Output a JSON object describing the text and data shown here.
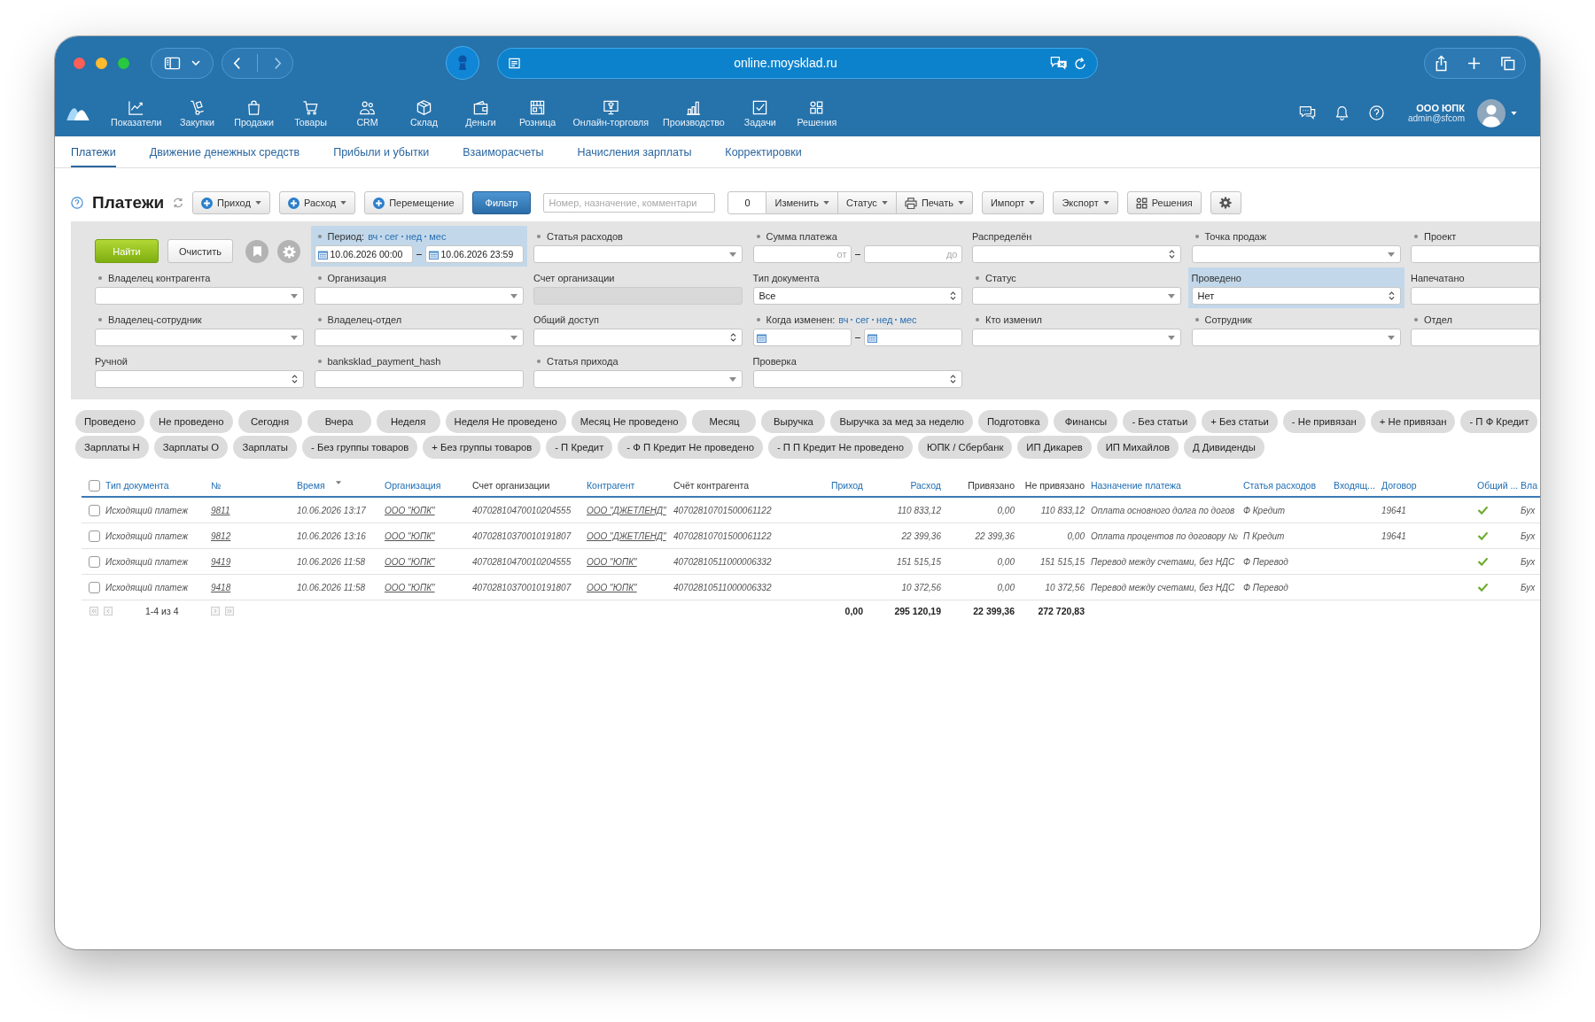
{
  "browser": {
    "url": "online.moysklad.ru"
  },
  "app_nav": {
    "items": [
      {
        "label": "Показатели"
      },
      {
        "label": "Закупки"
      },
      {
        "label": "Продажи"
      },
      {
        "label": "Товары"
      },
      {
        "label": "CRM"
      },
      {
        "label": "Склад"
      },
      {
        "label": "Деньги"
      },
      {
        "label": "Розница"
      },
      {
        "label": "Онлайн-торговля"
      },
      {
        "label": "Производство"
      },
      {
        "label": "Задачи"
      },
      {
        "label": "Решения"
      }
    ],
    "account": {
      "company": "ООО ЮПК",
      "email": "admin@sfcom"
    }
  },
  "tabs": [
    {
      "label": "Платежи",
      "selected": true
    },
    {
      "label": "Движение денежных средств",
      "selected": false
    },
    {
      "label": "Прибыли и убытки",
      "selected": false
    },
    {
      "label": "Взаиморасчеты",
      "selected": false
    },
    {
      "label": "Начисления зарплаты",
      "selected": false
    },
    {
      "label": "Корректировки",
      "selected": false
    }
  ],
  "toolbar": {
    "title": "Платежи",
    "buttons": [
      {
        "kind": "plus",
        "label": "Приход",
        "caret": true,
        "on": false
      },
      {
        "kind": "plus",
        "label": "Расход",
        "caret": true,
        "on": false
      },
      {
        "kind": "plus",
        "label": "Перемещение",
        "caret": false,
        "on": false
      },
      {
        "kind": "plain",
        "label": "Фильтр",
        "caret": false,
        "on": true
      }
    ],
    "search": {
      "placeholder": "Номер, назначение, комментари"
    },
    "selection": {
      "count": "0",
      "buttons": [
        {
          "kind": "plain",
          "label": "Изменить",
          "caret": true
        },
        {
          "kind": "plain",
          "label": "Статус",
          "caret": true
        },
        {
          "kind": "printer",
          "label": "Печать",
          "caret": true
        }
      ]
    },
    "more_buttons": [
      {
        "kind": "plain",
        "label": "Импорт",
        "caret": true
      },
      {
        "kind": "plain",
        "label": "Экспорт",
        "caret": true
      },
      {
        "kind": "apps",
        "label": "Решения",
        "caret": false
      }
    ]
  },
  "filter": {
    "find": "Найти",
    "clear": "Очистить",
    "fields": [
      {
        "label": "Период:",
        "kind": "date_range",
        "bulleted": true,
        "active": true,
        "disabled": false,
        "links": [
          "вч",
          "сег",
          "нед",
          "мес"
        ],
        "from": {
          "value": "10.06.2026 00:00"
        },
        "to": {
          "value": "10.06.2026 23:59"
        }
      },
      {
        "label": "Статья расходов",
        "kind": "dropdown",
        "bulleted": true,
        "active": false,
        "disabled": false
      },
      {
        "label": "Сумма платежа",
        "kind": "range",
        "bulleted": true,
        "active": false,
        "disabled": false,
        "from": {
          "placeholder": "от"
        },
        "to": {
          "placeholder": "до"
        }
      },
      {
        "label": "Распределён",
        "kind": "select",
        "bulleted": false,
        "active": false,
        "disabled": false
      },
      {
        "label": "Точка продаж",
        "kind": "dropdown",
        "bulleted": true,
        "active": false,
        "disabled": false
      },
      {
        "label": "Проект",
        "kind": "text",
        "bulleted": true,
        "active": false,
        "disabled": false
      },
      {
        "label": "Владелец контрагента",
        "kind": "dropdown",
        "bulleted": true,
        "active": false,
        "disabled": false
      },
      {
        "label": "Организация",
        "kind": "dropdown",
        "bulleted": true,
        "active": false,
        "disabled": false
      },
      {
        "label": "Счет организации",
        "kind": "text",
        "bulleted": false,
        "active": false,
        "disabled": true
      },
      {
        "label": "Тип документа",
        "kind": "select",
        "bulleted": false,
        "active": false,
        "disabled": false,
        "value": "Все"
      },
      {
        "label": "Статус",
        "kind": "dropdown",
        "bulleted": true,
        "active": false,
        "disabled": false
      },
      {
        "label": "Проведено",
        "kind": "select",
        "bulleted": false,
        "active": true,
        "disabled": false,
        "value": "Нет"
      },
      {
        "label": "Напечатано",
        "kind": "text",
        "bulleted": false,
        "active": false,
        "disabled": false
      },
      {
        "label": "Владелец-сотрудник",
        "kind": "dropdown",
        "bulleted": true,
        "active": false,
        "disabled": false
      },
      {
        "label": "Владелец-отдел",
        "kind": "dropdown",
        "bulleted": true,
        "active": false,
        "disabled": false
      },
      {
        "label": "Общий доступ",
        "kind": "select",
        "bulleted": false,
        "active": false,
        "disabled": false
      },
      {
        "label": "Когда изменен:",
        "kind": "date_range",
        "bulleted": true,
        "active": false,
        "disabled": false,
        "links": [
          "вч",
          "сег",
          "нед",
          "мес"
        ]
      },
      {
        "label": "Кто изменил",
        "kind": "dropdown",
        "bulleted": true,
        "active": false,
        "disabled": false
      },
      {
        "label": "Сотрудник",
        "kind": "dropdown",
        "bulleted": true,
        "active": false,
        "disabled": false
      },
      {
        "label": "Отдел",
        "kind": "text",
        "bulleted": true,
        "active": false,
        "disabled": false
      },
      {
        "label": "Ручной",
        "kind": "select",
        "bulleted": false,
        "active": false,
        "disabled": false
      },
      {
        "label": "banksklad_payment_hash",
        "kind": "text",
        "bulleted": true,
        "active": false,
        "disabled": false
      },
      {
        "label": "Статья прихода",
        "kind": "dropdown",
        "bulleted": true,
        "active": false,
        "disabled": false
      },
      {
        "label": "Проверка",
        "kind": "select",
        "bulleted": false,
        "active": false,
        "disabled": false
      }
    ]
  },
  "presets": [
    [
      "Проведено",
      "Не проведено",
      "Сегодня",
      "Вчера",
      "Неделя",
      "Неделя Не проведено",
      "Месяц Не проведено",
      "Месяц",
      "Выручка",
      "Выручка за мед за неделю",
      "Подготовка",
      "Финансы",
      "- Без статьи",
      "+ Без статьи",
      "- Не привязан",
      "+ Не привязан",
      "- П Ф Кредит"
    ],
    [
      "Зарплаты Н",
      "Зарплаты О",
      "Зарплаты",
      "- Без группы товаров",
      "+ Без группы товаров",
      "- П Кредит",
      "- Ф П Кредит Не проведено",
      "- П П Кредит Не проведено",
      "ЮПК / Сбербанк",
      "ИП Дикарев",
      "ИП Михайлов",
      "Д Дивиденды"
    ]
  ],
  "table": {
    "header_checked": false,
    "columns": [
      {
        "label": "Тип документа",
        "kind": "text",
        "sortable": true,
        "sorted": false
      },
      {
        "label": "№",
        "kind": "link",
        "sortable": true,
        "sorted": false
      },
      {
        "label": "Время",
        "kind": "text",
        "sortable": true,
        "sorted": true
      },
      {
        "label": "Организация",
        "kind": "link",
        "sortable": true,
        "sorted": false
      },
      {
        "label": "Счет организации",
        "kind": "text",
        "sortable": false,
        "sorted": false
      },
      {
        "label": "Контрагент",
        "kind": "link",
        "sortable": true,
        "sorted": false
      },
      {
        "label": "Счёт контрагента",
        "kind": "text",
        "sortable": false,
        "sorted": false
      },
      {
        "label": "Приход",
        "kind": "number",
        "sortable": true,
        "sorted": false
      },
      {
        "label": "Расход",
        "kind": "number",
        "sortable": true,
        "sorted": false
      },
      {
        "label": "Привязано",
        "kind": "number",
        "sortable": false,
        "sorted": false
      },
      {
        "label": "Не привязано",
        "kind": "number",
        "sortable": false,
        "sorted": false
      },
      {
        "label": "Назначение платежа",
        "kind": "text",
        "sortable": true,
        "sorted": false
      },
      {
        "label": "Статья расходов",
        "kind": "text",
        "sortable": true,
        "sorted": false
      },
      {
        "label": "Входящ...",
        "kind": "text",
        "sortable": true,
        "sorted": false
      },
      {
        "label": "Договор",
        "kind": "text",
        "sortable": true,
        "sorted": false
      },
      {
        "label": "Общий ...",
        "kind": "check",
        "sortable": true,
        "sorted": false
      },
      {
        "label": "Вла",
        "kind": "text",
        "sortable": true,
        "sorted": false
      }
    ],
    "rows": [
      {
        "checked": false,
        "type": "Исходящий платеж",
        "number": "9811",
        "time": "10.06.2026 13:17",
        "organization": "ООО \"ЮПК\"",
        "org_account": "40702810470010204555",
        "counterparty": "ООО \"ДЖЕТЛЕНД\"",
        "counterparty_account": "40702810701500061122",
        "expense": "110 833,12",
        "linked": "0,00",
        "unlinked": "110 833,12",
        "purpose": "Оплата основного долга по догов",
        "expense_item": "Ф Кредит",
        "contract": "19641",
        "shared_access": true,
        "column_17": "Бух"
      },
      {
        "checked": false,
        "type": "Исходящий платеж",
        "number": "9812",
        "time": "10.06.2026 13:16",
        "organization": "ООО \"ЮПК\"",
        "org_account": "40702810370010191807",
        "counterparty": "ООО \"ДЖЕТЛЕНД\"",
        "counterparty_account": "40702810701500061122",
        "expense": "22 399,36",
        "linked": "22 399,36",
        "unlinked": "0,00",
        "purpose": "Оплата процентов по договору №",
        "expense_item": "П Кредит",
        "contract": "19641",
        "shared_access": true,
        "column_17": "Бух"
      },
      {
        "checked": false,
        "type": "Исходящий платеж",
        "number": "9419",
        "time": "10.06.2026 11:58",
        "organization": "ООО \"ЮПК\"",
        "org_account": "40702810470010204555",
        "counterparty": "ООО \"ЮПК\"",
        "counterparty_account": "40702810511000006332",
        "expense": "151 515,15",
        "linked": "0,00",
        "unlinked": "151 515,15",
        "purpose": "Перевод между счетами, без НДС",
        "expense_item": "Ф Перевод",
        "shared_access": true,
        "column_17": "Бух"
      },
      {
        "checked": false,
        "type": "Исходящий платеж",
        "number": "9418",
        "time": "10.06.2026 11:58",
        "organization": "ООО \"ЮПК\"",
        "org_account": "40702810370010191807",
        "counterparty": "ООО \"ЮПК\"",
        "counterparty_account": "40702810511000006332",
        "expense": "10 372,56",
        "linked": "0,00",
        "unlinked": "10 372,56",
        "purpose": "Перевод между счетами, без НДС",
        "expense_item": "Ф Перевод",
        "shared_access": true,
        "column_17": "Бух"
      }
    ],
    "footer": {
      "range": "1-4 из 4",
      "totals": {
        "income": "0,00",
        "expense": "295 120,19",
        "linked": "22 399,36",
        "unlinked": "272 720,83"
      }
    }
  }
}
